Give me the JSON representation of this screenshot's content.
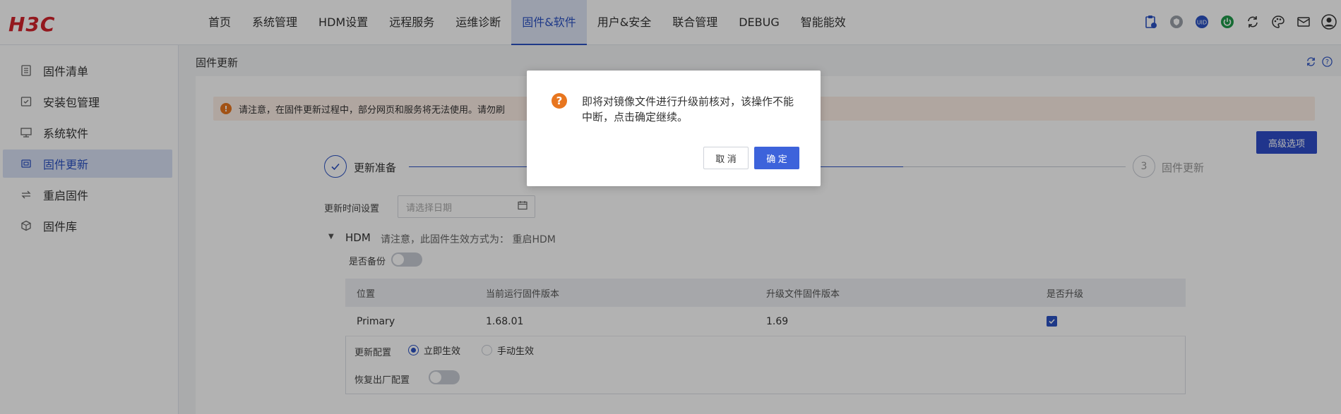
{
  "brand": {
    "logo_text": "H3C",
    "logo_color": "#d3232c"
  },
  "nav": {
    "items": [
      {
        "label": "首页"
      },
      {
        "label": "系统管理"
      },
      {
        "label": "HDM设置"
      },
      {
        "label": "远程服务"
      },
      {
        "label": "运维诊断"
      },
      {
        "label": "固件&软件",
        "active": true
      },
      {
        "label": "用户&安全"
      },
      {
        "label": "联合管理"
      },
      {
        "label": "DEBUG"
      },
      {
        "label": "智能能效"
      }
    ],
    "right_icons": [
      "clipboard-icon",
      "shield-icon",
      "uid-icon",
      "power-icon",
      "refresh-cycle-icon",
      "palette-icon",
      "mail-icon",
      "user-icon"
    ]
  },
  "sidebar": {
    "items": [
      {
        "label": "固件清单",
        "icon": "list-icon"
      },
      {
        "label": "安装包管理",
        "icon": "package-icon"
      },
      {
        "label": "系统软件",
        "icon": "monitor-icon"
      },
      {
        "label": "固件更新",
        "icon": "chip-icon",
        "active": true
      },
      {
        "label": "重启固件",
        "icon": "restart-icon"
      },
      {
        "label": "固件库",
        "icon": "cube-icon"
      }
    ]
  },
  "page": {
    "title": "固件更新",
    "warning": "请注意，在固件更新过程中，部分网页和服务将无法使用。请勿刷",
    "advanced_button": "高级选项",
    "steps": [
      {
        "label": "更新准备",
        "state": "done"
      },
      {
        "number": "3",
        "label": "固件更新",
        "state": "pending"
      }
    ],
    "update_time_label": "更新时间设置",
    "date_placeholder": "请选择日期",
    "hdm_section": {
      "title": "HDM",
      "note": "请注意，此固件生效方式为： 重启HDM",
      "backup_label": "是否备份",
      "backup_on": false
    },
    "table": {
      "headers": [
        "位置",
        "当前运行固件版本",
        "升级文件固件版本",
        "是否升级"
      ],
      "rows": [
        {
          "location": "Primary",
          "current": "1.68.01",
          "upgrade": "1.69",
          "checked": true
        }
      ]
    },
    "config": {
      "update_config_label": "更新配置",
      "option_immediate": "立即生效",
      "option_manual": "手动生效",
      "selected": "立即生效",
      "restore_label": "恢复出厂配置",
      "restore_on": false
    }
  },
  "dialog": {
    "message": "即将对镜像文件进行升级前核对，该操作不能中断，点击确定继续。",
    "cancel_label": "取 消",
    "ok_label": "确 定"
  },
  "colors": {
    "primary": "#2b52c3",
    "warning": "#e8761f",
    "ok_button": "#3d63db"
  }
}
